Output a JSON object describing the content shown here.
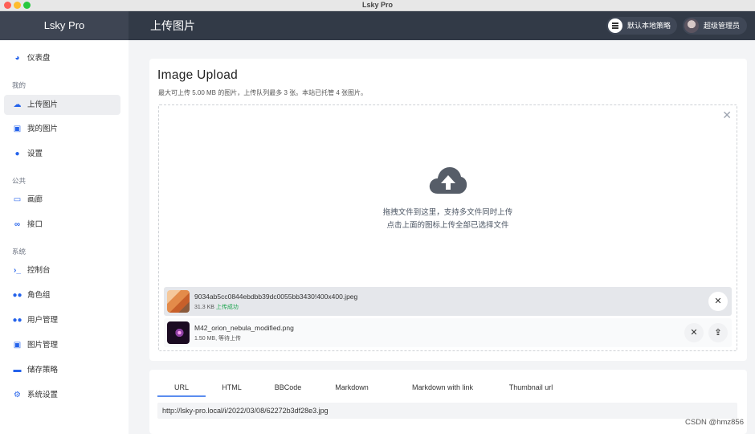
{
  "window": {
    "title": "Lsky Pro"
  },
  "header": {
    "brand": "Lsky Pro",
    "page_title": "上传图片",
    "strategy_label": "默认本地策略",
    "user_label": "超级管理员"
  },
  "sidebar": {
    "dashboard": "仪表盘",
    "section_mine": "我的",
    "upload": "上传图片",
    "my_images": "我的图片",
    "settings": "设置",
    "section_public": "公共",
    "gallery": "画廊",
    "api": "接口",
    "section_system": "系统",
    "console": "控制台",
    "roles": "角色组",
    "users": "用户管理",
    "images": "图片管理",
    "storage": "储存策略",
    "system_settings": "系统设置"
  },
  "upload": {
    "title": "Image Upload",
    "subtitle": "最大可上传 5.00 MB 的图片，上传队列最多 3 张。本站已托管 4 张图片。",
    "drop_line1": "拖拽文件到这里，支持多文件同时上传",
    "drop_line2": "点击上面的图标上传全部已选择文件",
    "files": [
      {
        "name": "9034ab5cc0844ebdbb39dc0055bb3430!400x400.jpeg",
        "size": "31.3 KB",
        "status": "上传成功"
      },
      {
        "name": "M42_orion_nebula_modified.png",
        "size": "1.50 MB",
        "status": "等待上传"
      }
    ]
  },
  "links": {
    "tabs": [
      "URL",
      "HTML",
      "BBCode",
      "Markdown",
      "Markdown with link",
      "Thumbnail url"
    ],
    "active_tab": "URL",
    "url": "http://lsky-pro.local/i/2022/03/08/62272b3df28e3.jpg"
  },
  "watermark": "CSDN @hmz856",
  "colors": {
    "header": "#323a47",
    "accent": "#2563eb",
    "success": "#16a34a"
  }
}
